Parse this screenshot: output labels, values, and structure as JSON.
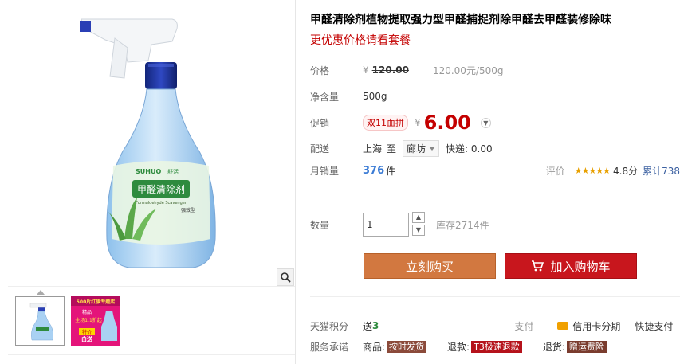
{
  "product": {
    "title": "甲醛清除剂植物提取强力型甲醛捕捉剂除甲醛去甲醛装修除味",
    "subtitle": "更优惠价格请看套餐",
    "bottle_brand": "SUHUO",
    "bottle_brand_cn": "舒活",
    "bottle_label_cn": "甲醛清除剂",
    "bottle_label_en": "Formaldehyde Scavenger",
    "bottle_type": "强效型"
  },
  "price": {
    "label": "价格",
    "currency": "¥",
    "original": "120.00",
    "unit_price": "120.00元/500g"
  },
  "net_weight": {
    "label": "净含量",
    "value": "500g"
  },
  "promo": {
    "label": "促销",
    "tag": "双11血拼",
    "currency": "¥",
    "price": "6.00"
  },
  "delivery": {
    "label": "配送",
    "from": "上海",
    "to_word": "至",
    "destination": "廊坊",
    "shipping": "快递: 0.00"
  },
  "sales": {
    "label": "月销量",
    "count": "376",
    "unit": "件",
    "rating_label": "评价",
    "stars": "★★★★★",
    "score": "4.8分",
    "cumulative": "累计738"
  },
  "quantity": {
    "label": "数量",
    "value": "1",
    "stock": "库存2714件"
  },
  "buttons": {
    "buy_now": "立刻购买",
    "add_to_cart": "加入购物车"
  },
  "points": {
    "label": "天猫积分",
    "prefix": "送",
    "value": "3",
    "pay_label": "支付",
    "pay_method_1": "信用卡分期",
    "pay_method_2": "快捷支付"
  },
  "service": {
    "label": "服务承诺",
    "item1_label": "商品:",
    "item1_tag": "按时发货",
    "item2_label": "退款:",
    "item2_tag": "T3极速退款",
    "item3_label": "退货:",
    "item3_tag": "赠运费险"
  },
  "thumb2": {
    "line1": "500片红旗专题店",
    "line2": "精品",
    "line3": "全场1.1折起",
    "line4": "特价",
    "line5": "白送"
  }
}
